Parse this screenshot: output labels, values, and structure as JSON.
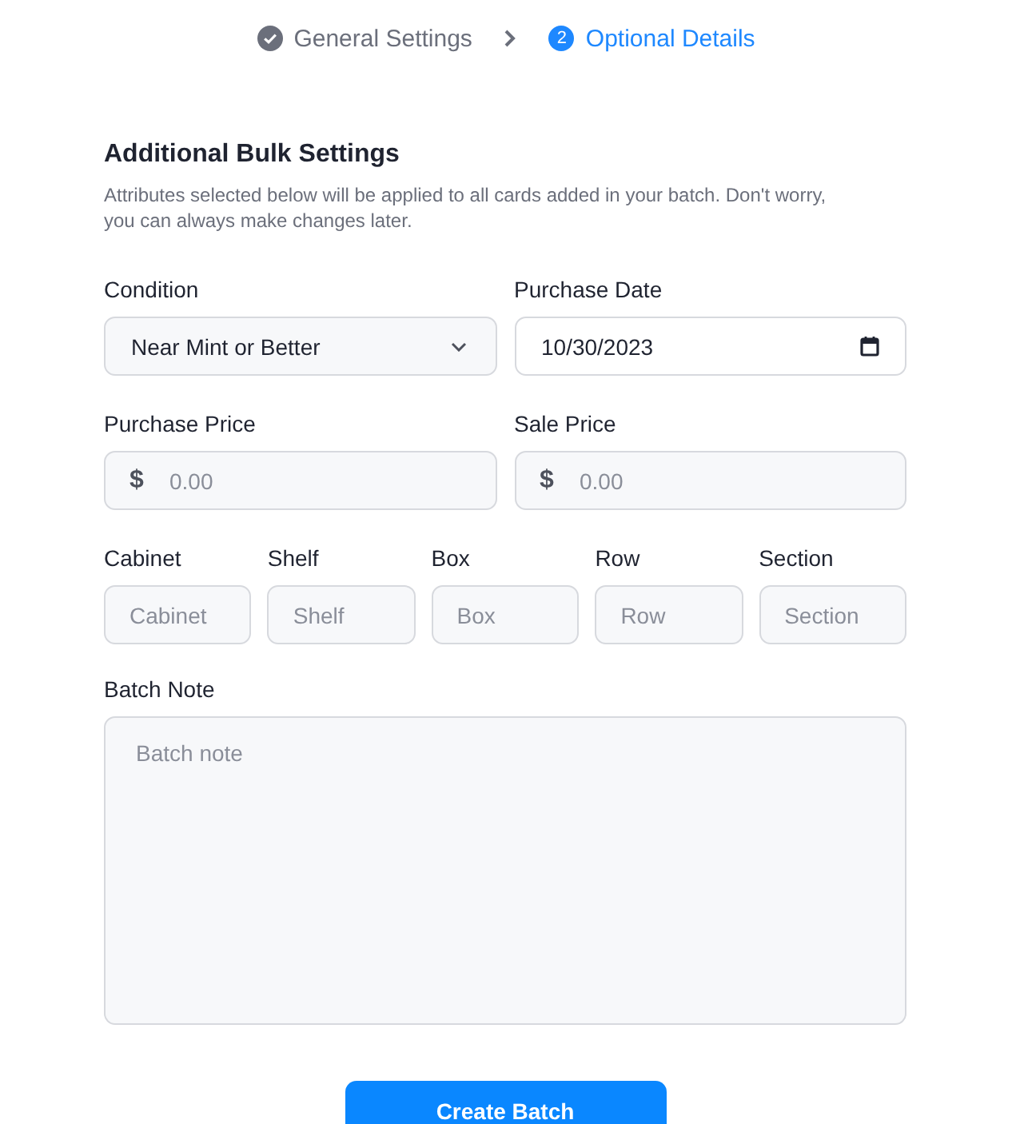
{
  "stepper": {
    "steps": [
      {
        "label": "General Settings",
        "kind": "done",
        "selected": false
      },
      {
        "label": "Optional Details",
        "kind": "current",
        "number": "2",
        "selected": true
      }
    ]
  },
  "form": {
    "title": "Additional Bulk Settings",
    "description": "Attributes selected below will be applied to all cards added in your batch. Don't worry, you can always make changes later.",
    "condition": {
      "label": "Condition",
      "value": "Near Mint or Better"
    },
    "purchase_date": {
      "label": "Purchase Date",
      "value": "10/30/2023"
    },
    "prices": [
      {
        "label": "Purchase Price",
        "prefix": "$",
        "placeholder": "0.00"
      },
      {
        "label": "Sale Price",
        "prefix": "$",
        "placeholder": "0.00"
      }
    ],
    "location": [
      {
        "label": "Cabinet",
        "placeholder": "Cabinet"
      },
      {
        "label": "Shelf",
        "placeholder": "Shelf"
      },
      {
        "label": "Box",
        "placeholder": "Box"
      },
      {
        "label": "Row",
        "placeholder": "Row"
      },
      {
        "label": "Section",
        "placeholder": "Section"
      }
    ],
    "batch_note": {
      "label": "Batch Note",
      "placeholder": "Batch note"
    },
    "submit": "Create Batch"
  }
}
